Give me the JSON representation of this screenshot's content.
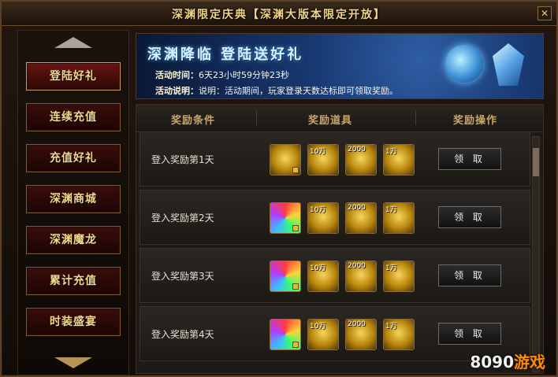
{
  "window": {
    "title": "深渊限定庆典【深渊大版本限定开放】",
    "close_glyph": "✕"
  },
  "sidebar": {
    "items": [
      {
        "label": "登陆好礼",
        "active": true
      },
      {
        "label": "连续充值"
      },
      {
        "label": "充值好礼"
      },
      {
        "label": "深渊商城"
      },
      {
        "label": "深渊魔龙"
      },
      {
        "label": "累计充值"
      },
      {
        "label": "时装盛宴"
      }
    ]
  },
  "banner": {
    "heading": "深渊降临 登陆送好礼",
    "time_label": "活动时间：",
    "time_value": "6天23小时59分钟23秒",
    "desc_label": "活动说明：",
    "desc_value": "说明：活动期间，玩家登录天数达标即可领取奖励。"
  },
  "table": {
    "headers": [
      "奖励条件",
      "奖励道具",
      "奖励操作"
    ],
    "claim_label": "领 取",
    "rows": [
      {
        "label": "登入奖励第1天",
        "items": [
          {
            "icon": "gold-key-icon",
            "qty": ""
          },
          {
            "icon": "gold-ingot-icon",
            "qty": "10万"
          },
          {
            "icon": "gold-bar-icon",
            "qty": "2000"
          },
          {
            "icon": "coin-sack-icon",
            "qty": "1万"
          }
        ]
      },
      {
        "label": "登入奖励第2天",
        "items": [
          {
            "icon": "rainbow-gem-icon",
            "qty": ""
          },
          {
            "icon": "gold-ingot-icon",
            "qty": "10万"
          },
          {
            "icon": "gold-bar-icon",
            "qty": "2000"
          },
          {
            "icon": "coin-sack-icon",
            "qty": "1万"
          }
        ]
      },
      {
        "label": "登入奖励第3天",
        "items": [
          {
            "icon": "rainbow-gem-icon",
            "qty": ""
          },
          {
            "icon": "gold-ingot-icon",
            "qty": "10万"
          },
          {
            "icon": "gold-bar-icon",
            "qty": "2000"
          },
          {
            "icon": "coin-sack-icon",
            "qty": "1万"
          }
        ]
      },
      {
        "label": "登入奖励第4天",
        "items": [
          {
            "icon": "rainbow-gem-icon",
            "qty": ""
          },
          {
            "icon": "gold-ingot-icon",
            "qty": "10万"
          },
          {
            "icon": "gold-bar-icon",
            "qty": "2000"
          },
          {
            "icon": "coin-sack-icon",
            "qty": "1万"
          }
        ]
      }
    ]
  },
  "watermark": {
    "text_left": "8090",
    "text_right": "游戏"
  }
}
